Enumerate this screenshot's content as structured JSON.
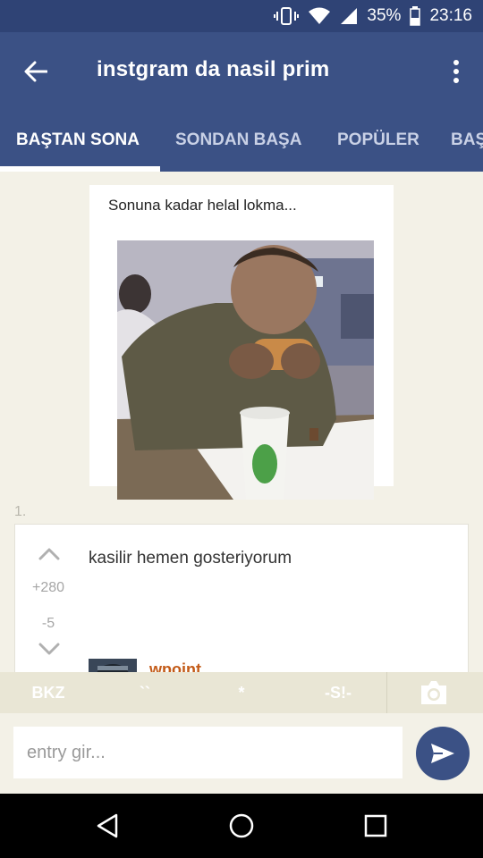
{
  "status_bar": {
    "battery": "35%",
    "time": "23:16",
    "icons": [
      "vibrate-icon",
      "wifi-icon",
      "signal-icon",
      "battery-icon"
    ]
  },
  "app_bar": {
    "title": "instgram da nasil prim",
    "back_icon": "arrow-left-icon",
    "menu_icon": "more-vertical-icon"
  },
  "tabs": [
    {
      "label": "BAŞTAN SONA",
      "active": true
    },
    {
      "label": "SONDAN BAŞA",
      "active": false
    },
    {
      "label": "POPÜLER",
      "active": false
    },
    {
      "label": "BAŞ",
      "active": false
    }
  ],
  "post_image": {
    "caption": "Sonuna kadar helal lokma..."
  },
  "entry": {
    "index": "1.",
    "text": "kasilir hemen gosteriyorum",
    "upvotes": "+280",
    "downvotes": "-5",
    "author": "wpoint"
  },
  "format_toolbar": {
    "buttons": [
      "BKZ",
      "``",
      "*",
      "-S!-"
    ],
    "camera_icon": "camera-icon"
  },
  "input": {
    "placeholder": "entry gir...",
    "send_icon": "send-icon"
  },
  "nav_bar": {
    "icons": [
      "nav-back-icon",
      "nav-home-icon",
      "nav-recents-icon"
    ]
  },
  "colors": {
    "primary": "#3b5185",
    "status_bar": "#2f4375",
    "background": "#f3f1e7",
    "author": "#c35b18"
  }
}
